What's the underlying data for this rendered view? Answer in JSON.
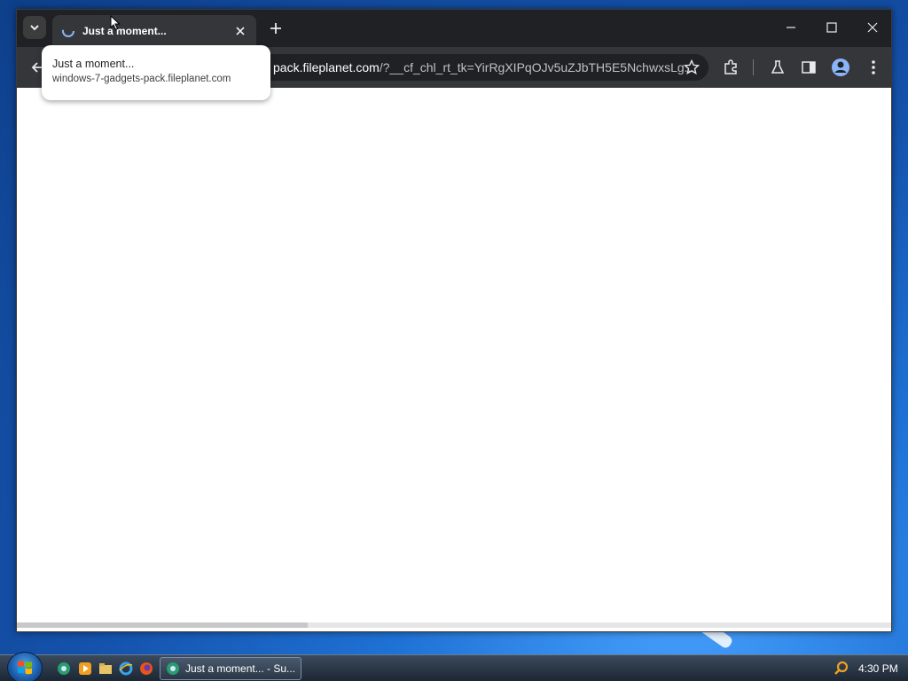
{
  "browser": {
    "tab": {
      "title": "Just a moment...",
      "close_icon": "close-icon",
      "favicon_icon": "loading-spinner-icon"
    },
    "new_tab_icon": "plus-icon",
    "window_controls": [
      "minimize-icon",
      "maximize-icon",
      "close-icon"
    ],
    "omnibox": {
      "host_text": "pack.fileplanet.com",
      "path_text": "/?__cf_chl_rt_tk=YirRgXIPqOJv5uZJbTH5E5NchwxsLg...",
      "bookmark_icon": "star-icon"
    },
    "toolbar_icons": [
      "extensions-icon",
      "labs-icon",
      "side-panel-icon",
      "profile-icon",
      "menu-icon"
    ],
    "tooltip": {
      "title": "Just a moment...",
      "url": "windows-7-gadgets-pack.fileplanet.com"
    }
  },
  "taskbar": {
    "quick_launch": [
      "chrome-icon",
      "media-player-icon",
      "explorer-icon",
      "internet-explorer-icon",
      "firefox-icon"
    ],
    "task_button_label": "Just a moment... - Su...",
    "clock": "4:30 PM"
  },
  "colors": {
    "titlebar": "#202124",
    "toolbar": "#35363a",
    "desktop_blue": "#1f72d6"
  }
}
